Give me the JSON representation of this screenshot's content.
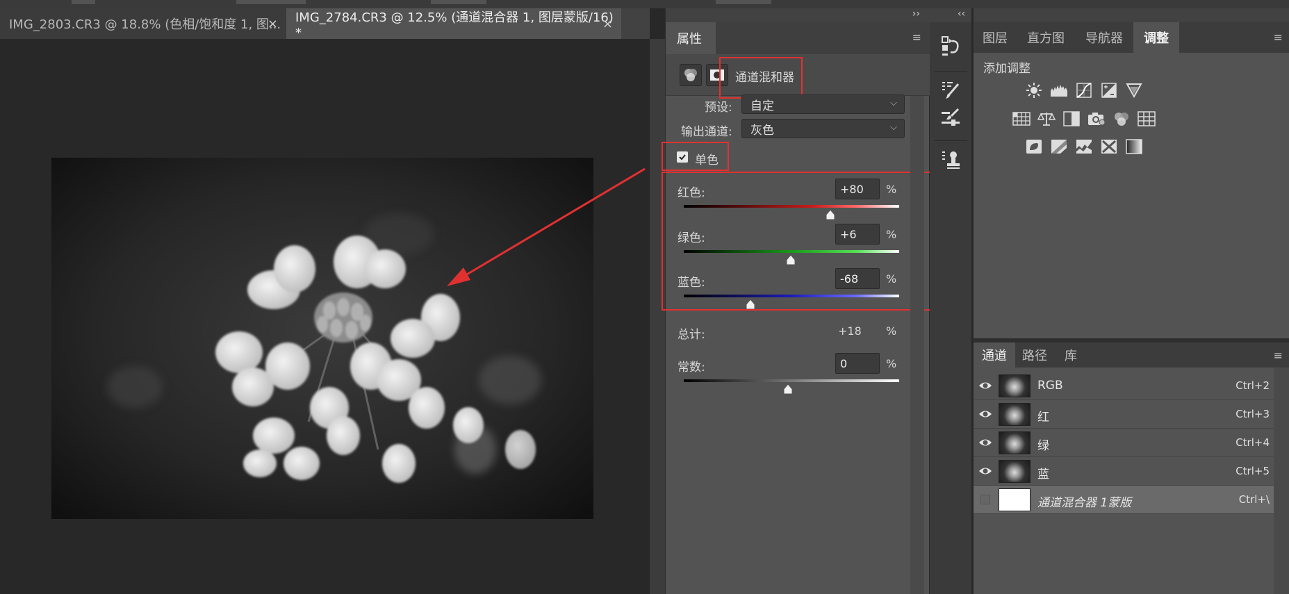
{
  "document_tabs": [
    {
      "title": "IMG_2803.CR3 @ 18.8% (色相/饱和度 1, 图...",
      "active": false,
      "close": "×"
    },
    {
      "title": "IMG_2784.CR3 @ 12.5% (通道混合器 1, 图层蒙版/16) *",
      "active": true,
      "close": "×"
    }
  ],
  "collapse_right": "››",
  "collapse_left": "‹‹",
  "properties": {
    "tab_label": "属性",
    "menu_icon": "≡",
    "adjustment_name": "通道混和器",
    "preset_label": "预设:",
    "preset_value": "自定",
    "output_label": "输出通道:",
    "output_value": "灰色",
    "monochrome_label": "单色",
    "monochrome_checked": true,
    "red_label": "红色:",
    "red_value": "+80",
    "red_level_pct": 80,
    "green_label": "绿色:",
    "green_value": "+6",
    "green_level_pct": 6,
    "blue_label": "蓝色:",
    "blue_value": "-68",
    "blue_level_pct": -68,
    "total_label": "总计:",
    "total_value": "+18",
    "constant_label": "常数:",
    "constant_value": "0",
    "constant_level_pct": 0,
    "percent": "%"
  },
  "right_panel": {
    "tabs": [
      "图层",
      "直方图",
      "导航器",
      "调整"
    ],
    "active_tab": "调整",
    "menu_icon": "≡",
    "add_adjustment_label": "添加调整",
    "adjustment_icons": [
      [
        "brightness-icon",
        "levels-icon",
        "curves-icon",
        "exposure-icon",
        "vibrance-icon"
      ],
      [
        "hue-saturation-icon",
        "color-balance-icon",
        "black-white-icon",
        "photo-filter-icon",
        "channel-mixer-icon",
        "color-lookup-icon"
      ],
      [
        "invert-icon",
        "posterize-icon",
        "threshold-icon",
        "selective-color-icon",
        "gradient-map-icon"
      ]
    ]
  },
  "channels": {
    "tabs": [
      "通道",
      "路径",
      "库"
    ],
    "active_tab": "通道",
    "menu_icon": "≡",
    "rows": [
      {
        "name": "RGB",
        "shortcut": "Ctrl+2",
        "visible": true
      },
      {
        "name": "红",
        "shortcut": "Ctrl+3",
        "visible": true
      },
      {
        "name": "绿",
        "shortcut": "Ctrl+4",
        "visible": true
      },
      {
        "name": "蓝",
        "shortcut": "Ctrl+5",
        "visible": true
      },
      {
        "name": "通道混合器 1蒙版",
        "shortcut": "Ctrl+\\",
        "visible": false
      }
    ]
  },
  "colors": {
    "highlight_red": "#e03131",
    "panel_bg": "#535353",
    "canvas_bg": "#282828"
  }
}
